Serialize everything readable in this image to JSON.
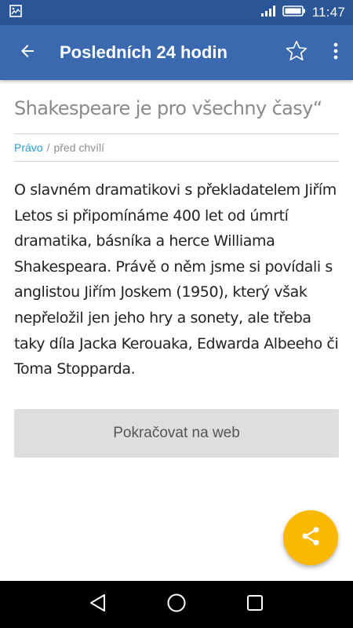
{
  "status_bar": {
    "time": "11:47",
    "icons": [
      "image-icon",
      "signal-icon",
      "battery-icon"
    ]
  },
  "app_bar": {
    "title": "Posledních 24 hodin",
    "back_icon": "arrow-back-icon",
    "favorite_icon": "star-outline-icon",
    "menu_icon": "more-vert-icon"
  },
  "article": {
    "title": "Shakespeare je pro všechny časy“",
    "category": "Právo",
    "separator": "/",
    "time": "před chvílí",
    "body": "O slavném dramatikovi s překladatelem Jiřím Letos si připomínáme 400 let od úmrtí dramatika, básníka a herce Williama Shakespeara. Právě o něm jsme si povídali s anglistou Jiřím Joskem (1950), který však nepřeložil jen jeho hry a sonety, ale třeba taky díla Jacka Kerouaka, Edwarda Albeeho či Toma Stopparda."
  },
  "continue_button": {
    "label": "Pokračovat na web"
  },
  "fab": {
    "icon": "share-icon"
  },
  "nav_bar": {
    "icons": [
      "nav-back-icon",
      "nav-home-icon",
      "nav-recents-icon"
    ]
  },
  "colors": {
    "status_bar": "#2a5596",
    "app_bar": "#3a69b0",
    "category": "#23a0d7",
    "fab": "#fbb800",
    "button": "#dedede"
  }
}
